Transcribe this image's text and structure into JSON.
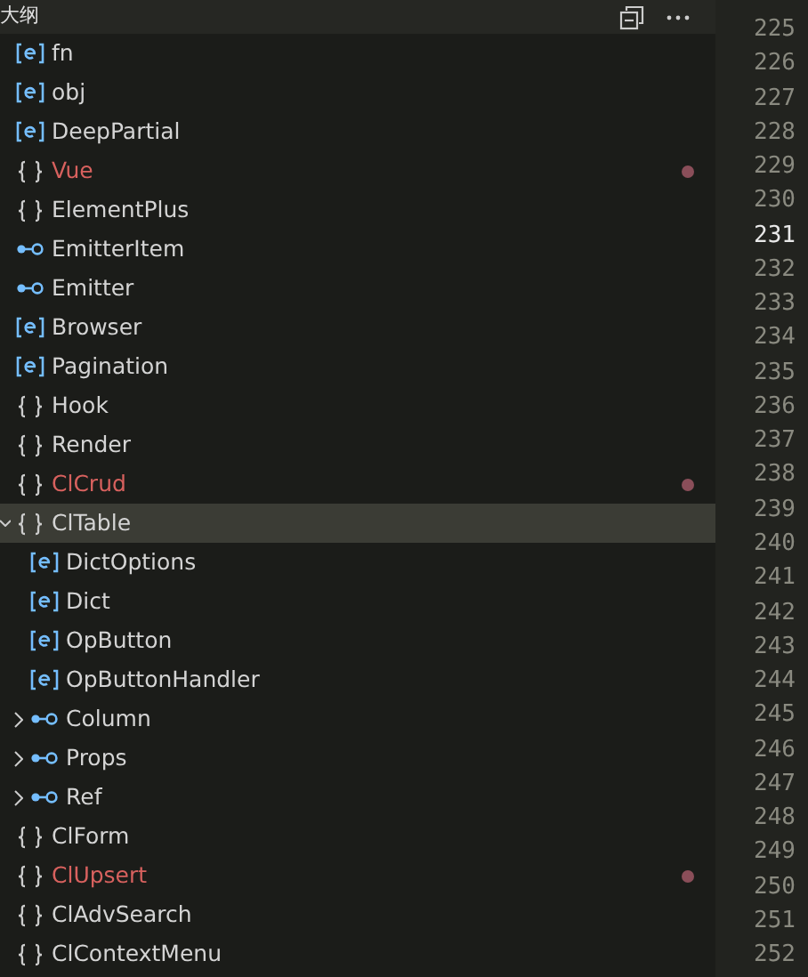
{
  "outline": {
    "title": "大纲",
    "items": [
      {
        "label": "fn",
        "kind": "variable",
        "modified": false,
        "selected": false
      },
      {
        "label": "obj",
        "kind": "variable",
        "modified": false,
        "selected": false
      },
      {
        "label": "DeepPartial",
        "kind": "variable",
        "modified": false,
        "selected": false
      },
      {
        "label": "Vue",
        "kind": "namespace",
        "modified": true,
        "selected": false
      },
      {
        "label": "ElementPlus",
        "kind": "namespace",
        "modified": false,
        "selected": false
      },
      {
        "label": "EmitterItem",
        "kind": "interface",
        "modified": false,
        "selected": false
      },
      {
        "label": "Emitter",
        "kind": "interface",
        "modified": false,
        "selected": false
      },
      {
        "label": "Browser",
        "kind": "variable",
        "modified": false,
        "selected": false
      },
      {
        "label": "Pagination",
        "kind": "variable",
        "modified": false,
        "selected": false
      },
      {
        "label": "Hook",
        "kind": "namespace",
        "modified": false,
        "selected": false
      },
      {
        "label": "Render",
        "kind": "namespace",
        "modified": false,
        "selected": false
      },
      {
        "label": "ClCrud",
        "kind": "namespace",
        "modified": true,
        "selected": false
      },
      {
        "label": "ClTable",
        "kind": "namespace",
        "modified": false,
        "selected": true,
        "expanded": true,
        "children": [
          {
            "label": "DictOptions",
            "kind": "variable",
            "modified": false,
            "selected": false
          },
          {
            "label": "Dict",
            "kind": "variable",
            "modified": false,
            "selected": false
          },
          {
            "label": "OpButton",
            "kind": "variable",
            "modified": false,
            "selected": false
          },
          {
            "label": "OpButtonHandler",
            "kind": "variable",
            "modified": false,
            "selected": false
          },
          {
            "label": "Column",
            "kind": "interface",
            "modified": false,
            "selected": false,
            "expanded": false
          },
          {
            "label": "Props",
            "kind": "interface",
            "modified": false,
            "selected": false,
            "expanded": false
          },
          {
            "label": "Ref",
            "kind": "interface",
            "modified": false,
            "selected": false,
            "expanded": false
          }
        ]
      },
      {
        "label": "ClForm",
        "kind": "namespace",
        "modified": false,
        "selected": false
      },
      {
        "label": "ClUpsert",
        "kind": "namespace",
        "modified": true,
        "selected": false
      },
      {
        "label": "ClAdvSearch",
        "kind": "namespace",
        "modified": false,
        "selected": false
      },
      {
        "label": "ClContextMenu",
        "kind": "namespace",
        "modified": false,
        "selected": false
      }
    ]
  },
  "line_numbers": [
    {
      "text": "225",
      "current": false
    },
    {
      "text": "226",
      "current": false
    },
    {
      "text": "227",
      "current": false
    },
    {
      "text": "228",
      "current": false
    },
    {
      "text": "229",
      "current": false
    },
    {
      "text": "230",
      "current": false
    },
    {
      "text": "231",
      "current": true
    },
    {
      "text": "232",
      "current": false
    },
    {
      "text": "233",
      "current": false
    },
    {
      "text": "234",
      "current": false
    },
    {
      "text": "235",
      "current": false
    },
    {
      "text": "236",
      "current": false
    },
    {
      "text": "237",
      "current": false
    },
    {
      "text": "238",
      "current": false
    },
    {
      "text": "239",
      "current": false
    },
    {
      "text": "240",
      "current": false
    },
    {
      "text": "241",
      "current": false
    },
    {
      "text": "242",
      "current": false
    },
    {
      "text": "243",
      "current": false
    },
    {
      "text": "244",
      "current": false
    },
    {
      "text": "245",
      "current": false
    },
    {
      "text": "246",
      "current": false
    },
    {
      "text": "247",
      "current": false
    },
    {
      "text": "248",
      "current": false
    },
    {
      "text": "249",
      "current": false
    },
    {
      "text": "250",
      "current": false
    },
    {
      "text": "251",
      "current": false
    },
    {
      "text": "252",
      "current": false
    }
  ]
}
